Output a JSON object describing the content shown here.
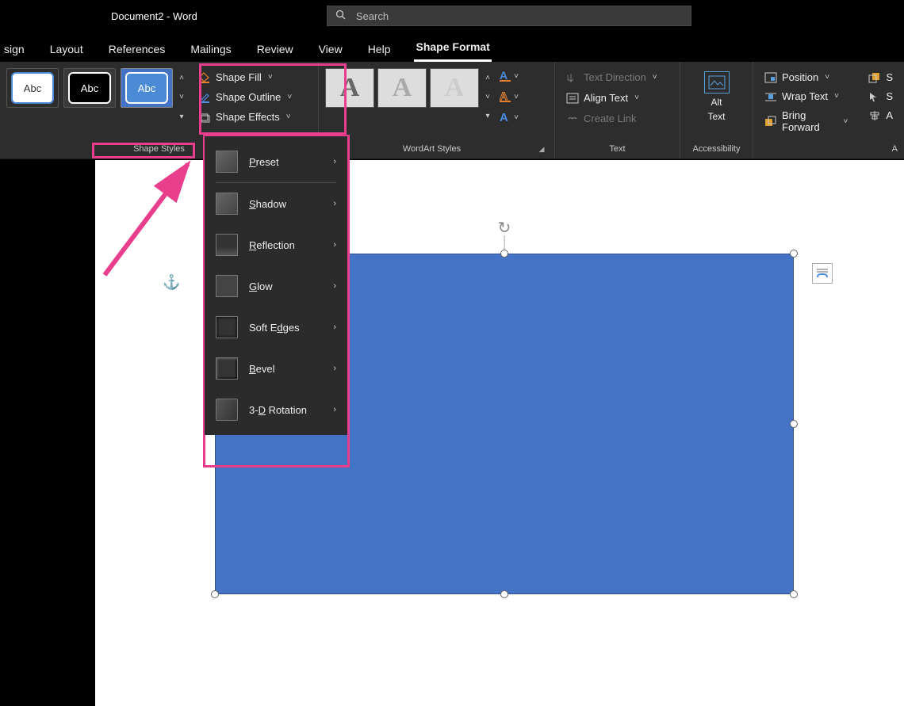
{
  "title": "Document2  -  Word",
  "search": {
    "placeholder": "Search"
  },
  "tabs": {
    "t0": "sign",
    "t1": "Layout",
    "t2": "References",
    "t3": "Mailings",
    "t4": "Review",
    "t5": "View",
    "t6": "Help",
    "t7": "Shape Format"
  },
  "groups": {
    "shape_styles": "Shape Styles",
    "wordart": "WordArt Styles",
    "text": "Text",
    "accessibility": "Accessibility",
    "arrange_partial": "A"
  },
  "shape": {
    "thumb_text": "Abc",
    "fill": "Shape Fill",
    "outline": "Shape Outline",
    "effects": "Shape Effects"
  },
  "wa_char": "A",
  "text_group": {
    "direction": "Text Direction",
    "align": "Align Text",
    "create_link": "Create Link"
  },
  "alt_text": {
    "l1": "Alt",
    "l2": "Text"
  },
  "arrange": {
    "position": "Position",
    "wrap": "Wrap Text",
    "bring_forward": "Bring Forward",
    "s": "S",
    "a": "A"
  },
  "effects_menu": {
    "preset": "reset",
    "shadow": "hadow",
    "reflection": "eflection",
    "glow": "low",
    "soft": "Soft E",
    "soft2": "dges",
    "bevel": "evel",
    "rot": "3-D",
    "rot2": " Rotation",
    "p": "P",
    "s": "S",
    "r": "R",
    "g": "G",
    "b": "B"
  }
}
